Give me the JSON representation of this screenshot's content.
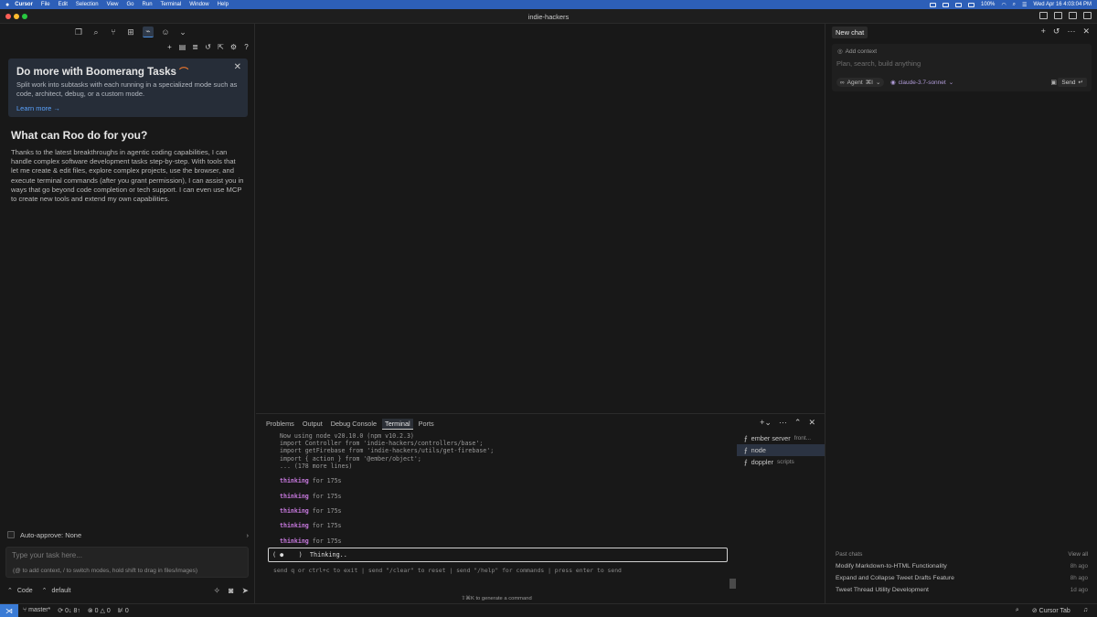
{
  "menubar": {
    "app": "Cursor",
    "items": [
      "File",
      "Edit",
      "Selection",
      "View",
      "Go",
      "Run",
      "Terminal",
      "Window",
      "Help"
    ],
    "clock": "Wed Apr 16  4:03:04 PM",
    "battery": "100%"
  },
  "window": {
    "title": "indie-hackers"
  },
  "roo": {
    "banner_title": "Do more with Boomerang Tasks",
    "banner_desc": "Split work into subtasks with each running in a specialized mode such as code, architect, debug, or a custom mode.",
    "banner_link": "Learn more →",
    "heading": "What can Roo do for you?",
    "description": "Thanks to the latest breakthroughs in agentic coding capabilities, I can handle complex software development tasks step-by-step. With tools that let me create & edit files, explore complex projects, use the browser, and execute terminal commands (after you grant permission), I can assist you in ways that go beyond code completion or tech support. I can even use MCP to create new tools and extend my own capabilities.",
    "auto_approve": "Auto-approve: None",
    "task_placeholder": "Type your task here...",
    "task_hint": "(@ to add context, / to switch modes, hold shift to drag in files/images)",
    "mode": "Code",
    "profile": "default"
  },
  "panel": {
    "tabs": [
      "Problems",
      "Output",
      "Debug Console",
      "Terminal",
      "Ports"
    ],
    "active_tab": "Terminal",
    "terminal_lines": [
      "Now using node v20.10.0 (npm v10.2.3)",
      "import Controller from 'indie-hackers/controllers/base';",
      "import getFirebase from 'indie-hackers/utils/get-firebase';",
      "import { action } from '@ember/object';",
      "... (178 more lines)"
    ],
    "thinking_word": "thinking",
    "thinking_suffix": "for 175s",
    "input_text": "( ●    )  Thinking..",
    "hint": "send q or ctrl+c to exit | send \"/clear\" to reset | send \"/help\" for commands | press enter to send",
    "gen_hint": "⇧⌘K to generate a command",
    "terminals": [
      {
        "name": "ember server",
        "sub": "front..."
      },
      {
        "name": "node",
        "sub": ""
      },
      {
        "name": "doppler",
        "sub": "scripts"
      }
    ]
  },
  "chat": {
    "tab": "New chat",
    "add_context": "Add context",
    "placeholder": "Plan, search, build anything",
    "agent": "Agent",
    "agent_shortcut": "⌘I",
    "model": "claude-3.7-sonnet",
    "send": "Send",
    "past_label": "Past chats",
    "view_all": "View all",
    "past": [
      {
        "title": "Modify Markdown-to-HTML Functionality",
        "time": "8h ago"
      },
      {
        "title": "Expand and Collapse Tweet Drafts Feature",
        "time": "8h ago"
      },
      {
        "title": "Tweet Thread Utility Development",
        "time": "1d ago"
      }
    ]
  },
  "status": {
    "branch": "master*",
    "sync": "0↓ 8↑",
    "errors": "0",
    "warnings": "0",
    "ports": "0",
    "cursor_tab": "Cursor Tab"
  }
}
